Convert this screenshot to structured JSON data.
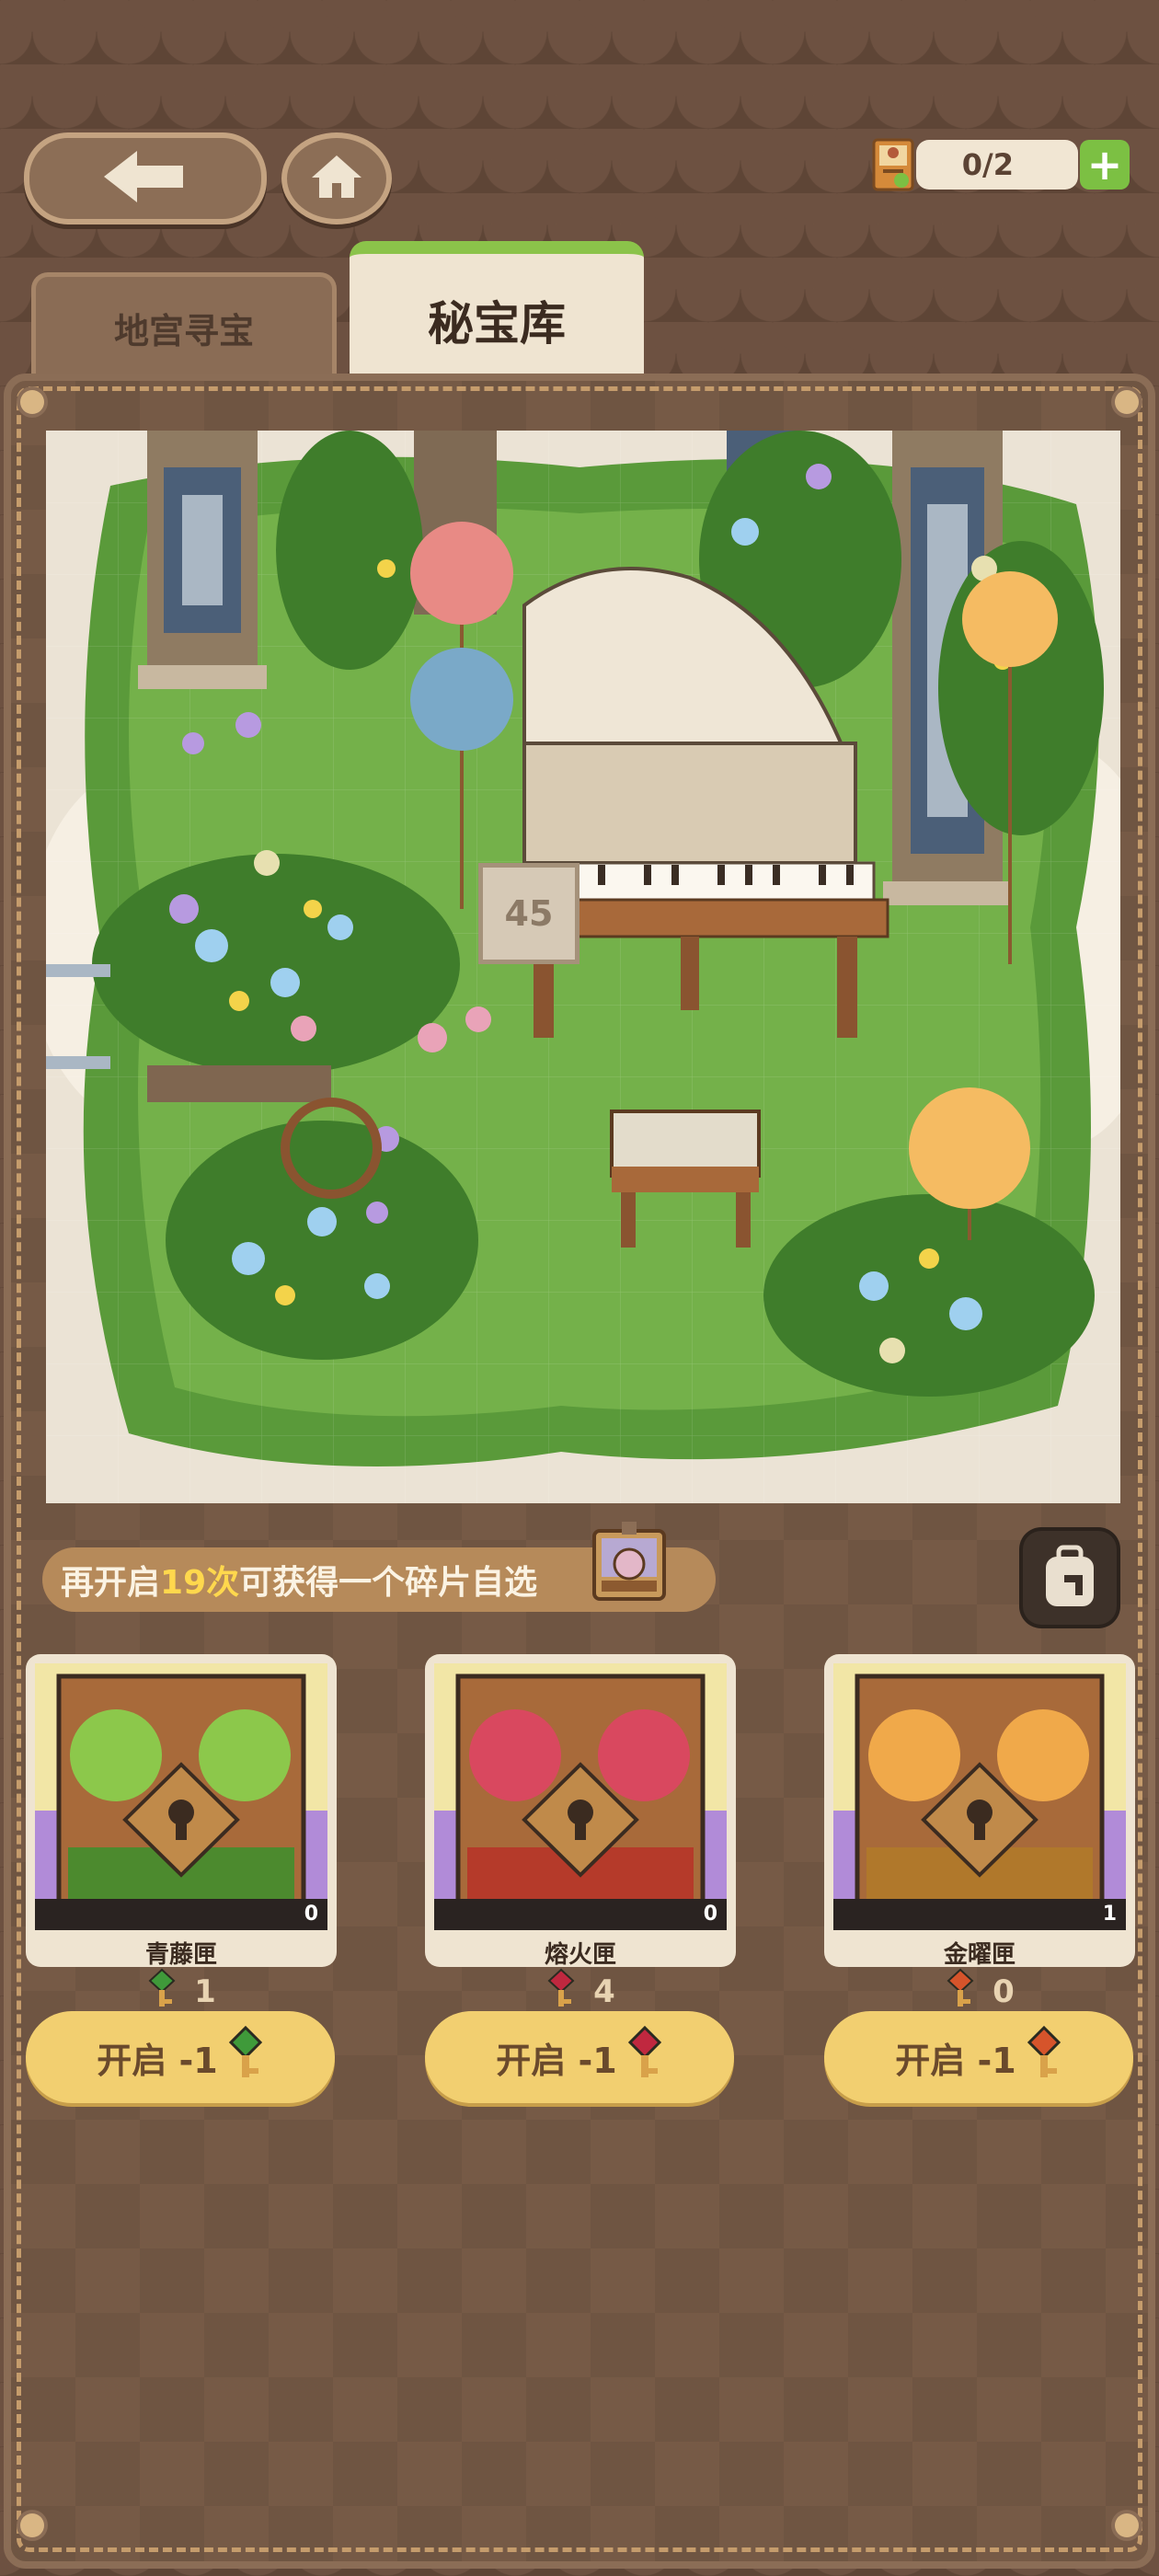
{
  "header": {
    "back_icon": "left-arrow-icon",
    "home_icon": "home-icon",
    "counter_icon": "card-stack-icon",
    "counter_text": "0/2",
    "plus_label": "+"
  },
  "tabs": [
    {
      "label": "地宫寻宝",
      "active": false
    },
    {
      "label": "秘宝库",
      "active": true
    }
  ],
  "scene": {
    "piece_number": "45"
  },
  "progress": {
    "prefix": "再开启",
    "count": "19次",
    "suffix": "可获得一个碎片自选"
  },
  "boxes": [
    {
      "name": "青藤匣",
      "owned": "0",
      "keys": "1",
      "button_label": "开启  -1",
      "key_color": "#3f9a3a",
      "balloon_color": "#8cc84b",
      "base_color": "#4c8a2e"
    },
    {
      "name": "熔火匣",
      "owned": "0",
      "keys": "4",
      "button_label": "开启  -1",
      "key_color": "#c0283f",
      "balloon_color": "#d9485f",
      "base_color": "#b53a2a"
    },
    {
      "name": "金曜匣",
      "owned": "1",
      "keys": "0",
      "button_label": "开启  -1",
      "key_color": "#d6542b",
      "balloon_color": "#f0a94a",
      "base_color": "#b0782b"
    }
  ],
  "colors": {
    "accent_green": "#8bc34a",
    "button_yellow": "#f2cf70",
    "highlight": "#ffd84d"
  }
}
